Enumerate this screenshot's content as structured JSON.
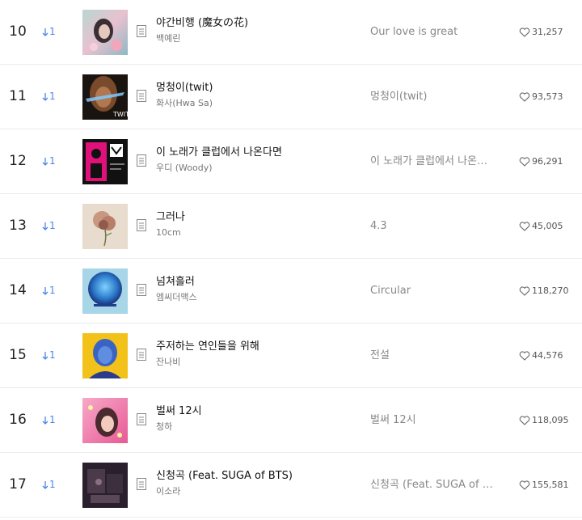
{
  "rows": [
    {
      "rank": "10",
      "change": "1",
      "title": "야간비행 (魔女の花)",
      "artist": "백예린",
      "album": "Our love is great",
      "likes": "31,257",
      "cover": "cover-10"
    },
    {
      "rank": "11",
      "change": "1",
      "title": "멍청이(twit)",
      "artist": "화사(Hwa Sa)",
      "album": "멍청이(twit)",
      "likes": "93,573",
      "cover": "cover-11"
    },
    {
      "rank": "12",
      "change": "1",
      "title": "이 노래가 클럽에서 나온다면",
      "artist": "우디 (Woody)",
      "album": "이 노래가 클럽에서 나온…",
      "likes": "96,291",
      "cover": "cover-12"
    },
    {
      "rank": "13",
      "change": "1",
      "title": "그러나",
      "artist": "10cm",
      "album": "4.3",
      "likes": "45,005",
      "cover": "cover-13"
    },
    {
      "rank": "14",
      "change": "1",
      "title": "넘쳐흘러",
      "artist": "엠씨더맥스",
      "album": "Circular",
      "likes": "118,270",
      "cover": "cover-14"
    },
    {
      "rank": "15",
      "change": "1",
      "title": "주저하는 연인들을 위해",
      "artist": "잔나비",
      "album": "전설",
      "likes": "44,576",
      "cover": "cover-15"
    },
    {
      "rank": "16",
      "change": "1",
      "title": "벌써 12시",
      "artist": "청하",
      "album": "벌써 12시",
      "likes": "118,095",
      "cover": "cover-16"
    },
    {
      "rank": "17",
      "change": "1",
      "title": "신청곡 (Feat. SUGA of BTS)",
      "artist": "이소라",
      "album": "신청곡 (Feat. SUGA of BT…",
      "likes": "155,581",
      "cover": "cover-17"
    }
  ],
  "icons": {
    "change": "arrow-down-icon",
    "lyrics": "lyrics-icon",
    "like": "heart-icon"
  },
  "colors": {
    "change": "#4a86e8",
    "divider": "#ececec"
  }
}
